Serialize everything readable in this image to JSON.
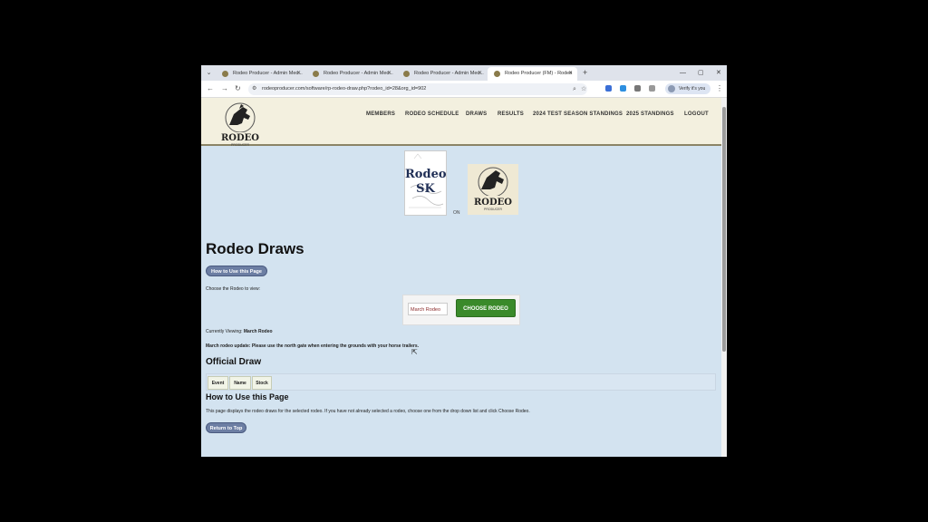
{
  "browser": {
    "tabs": [
      {
        "title": "Rodeo Producer - Admin Mec...",
        "active": false
      },
      {
        "title": "Rodeo Producer - Admin Mec...",
        "active": false
      },
      {
        "title": "Rodeo Producer - Admin Mec...",
        "active": false
      },
      {
        "title": "Rodeo Producer (FM) - Rodeo",
        "active": true
      }
    ],
    "new_tab": "+",
    "url": "rodeoproducer.com/software/rp-rodeo-draw.php?rodeo_id=28&org_id=902",
    "profile_label": "Verify it's you",
    "window_controls": {
      "minimize": "—",
      "maximize": "▢",
      "close": "✕"
    }
  },
  "site": {
    "logo_text": "RODEO",
    "logo_sub": "PRODUCER",
    "nav": [
      "MEMBERS",
      "RODEO SCHEDULE",
      "DRAWS",
      "RESULTS",
      "2024 TEST SEASON STANDINGS",
      "2025 STANDINGS",
      "LOGOUT"
    ]
  },
  "sponsor": {
    "line1": "Rodeo",
    "line2": "SK",
    "on_label": "ON",
    "logo_text": "RODEO",
    "logo_sub": "PRODUCER"
  },
  "page": {
    "title": "Rodeo Draws",
    "how_to_button": "How to Use this Page",
    "choose_label": "Choose the Rodeo to view:",
    "selected_rodeo": "March Rodeo",
    "choose_button": "CHOOSE RODEO",
    "currently_viewing_label": "Currently Viewing:",
    "currently_viewing_value": "March Rodeo",
    "update_text": "March rodeo update: Please use the north gate when entering the grounds with your horse trailers.",
    "official_draw_heading": "Official Draw",
    "table_headers": [
      "Event",
      "Name",
      "Stock"
    ],
    "how_to_heading": "How to Use this Page",
    "how_to_text": "This page displays the rodeo draws for the selected rodeo. If you have not already selected a rodeo, choose one from the drop down list and click Choose Rodeo.",
    "return_button": "Return to Top"
  },
  "colors": {
    "page_bg": "#d3e3f0",
    "header_bg": "#f3f0df",
    "pill_button": "#6c7ea3",
    "choose_button": "#3a8a2a"
  }
}
